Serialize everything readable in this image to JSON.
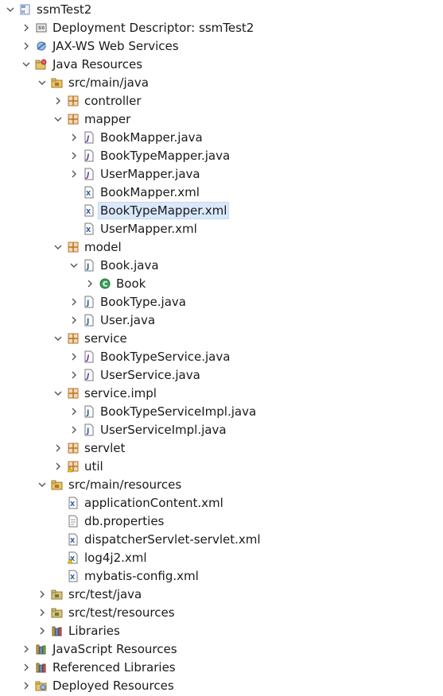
{
  "tree": [
    {
      "label": "ssmTest2",
      "icon": "web-project-icon",
      "level": 0,
      "expander": "expanded"
    },
    {
      "label": "Deployment Descriptor: ssmTest2",
      "icon": "deployment-descriptor-icon",
      "level": 1,
      "expander": "collapsed"
    },
    {
      "label": "JAX-WS Web Services",
      "icon": "web-services-icon",
      "level": 1,
      "expander": "collapsed"
    },
    {
      "label": "Java Resources",
      "icon": "java-resources-icon",
      "level": 1,
      "expander": "expanded"
    },
    {
      "label": "src/main/java",
      "icon": "source-folder-icon",
      "level": 2,
      "expander": "expanded"
    },
    {
      "label": "controller",
      "icon": "package-icon",
      "level": 3,
      "expander": "collapsed"
    },
    {
      "label": "mapper",
      "icon": "package-icon",
      "level": 3,
      "expander": "expanded"
    },
    {
      "label": "BookMapper.java",
      "icon": "java-interface-file-icon",
      "level": 4,
      "expander": "collapsed"
    },
    {
      "label": "BookTypeMapper.java",
      "icon": "java-interface-file-icon",
      "level": 4,
      "expander": "collapsed"
    },
    {
      "label": "UserMapper.java",
      "icon": "java-interface-file-icon",
      "level": 4,
      "expander": "collapsed"
    },
    {
      "label": "BookMapper.xml",
      "icon": "xml-file-icon",
      "level": 4,
      "expander": "none"
    },
    {
      "label": "BookTypeMapper.xml",
      "icon": "xml-file-icon",
      "level": 4,
      "expander": "none",
      "selected": true
    },
    {
      "label": "UserMapper.xml",
      "icon": "xml-file-icon",
      "level": 4,
      "expander": "none"
    },
    {
      "label": "model",
      "icon": "package-icon",
      "level": 3,
      "expander": "expanded"
    },
    {
      "label": "Book.java",
      "icon": "java-file-icon",
      "level": 4,
      "expander": "expanded"
    },
    {
      "label": "Book",
      "icon": "class-icon",
      "level": 5,
      "expander": "collapsed"
    },
    {
      "label": "BookType.java",
      "icon": "java-file-icon",
      "level": 4,
      "expander": "collapsed"
    },
    {
      "label": "User.java",
      "icon": "java-file-icon",
      "level": 4,
      "expander": "collapsed"
    },
    {
      "label": "service",
      "icon": "package-icon",
      "level": 3,
      "expander": "expanded"
    },
    {
      "label": "BookTypeService.java",
      "icon": "java-interface-file-icon",
      "level": 4,
      "expander": "collapsed"
    },
    {
      "label": "UserService.java",
      "icon": "java-interface-file-icon",
      "level": 4,
      "expander": "collapsed"
    },
    {
      "label": "service.impl",
      "icon": "package-icon",
      "level": 3,
      "expander": "expanded"
    },
    {
      "label": "BookTypeServiceImpl.java",
      "icon": "java-file-icon",
      "level": 4,
      "expander": "collapsed"
    },
    {
      "label": "UserServiceImpl.java",
      "icon": "java-file-icon",
      "level": 4,
      "expander": "collapsed"
    },
    {
      "label": "servlet",
      "icon": "package-icon",
      "level": 3,
      "expander": "collapsed"
    },
    {
      "label": "util",
      "icon": "package-warning-icon",
      "level": 3,
      "expander": "collapsed"
    },
    {
      "label": "src/main/resources",
      "icon": "source-folder-icon",
      "level": 2,
      "expander": "expanded"
    },
    {
      "label": "applicationContent.xml",
      "icon": "xml-file-icon",
      "level": 3,
      "expander": "none"
    },
    {
      "label": "db.properties",
      "icon": "text-file-icon",
      "level": 3,
      "expander": "none"
    },
    {
      "label": "dispatcherServlet-servlet.xml",
      "icon": "xml-file-icon",
      "level": 3,
      "expander": "none"
    },
    {
      "label": "log4j2.xml",
      "icon": "xml-warning-icon",
      "level": 3,
      "expander": "none"
    },
    {
      "label": "mybatis-config.xml",
      "icon": "xml-file-icon",
      "level": 3,
      "expander": "none"
    },
    {
      "label": "src/test/java",
      "icon": "test-folder-icon",
      "level": 2,
      "expander": "collapsed"
    },
    {
      "label": "src/test/resources",
      "icon": "test-folder-icon",
      "level": 2,
      "expander": "collapsed"
    },
    {
      "label": "Libraries",
      "icon": "libraries-icon",
      "level": 2,
      "expander": "collapsed"
    },
    {
      "label": "JavaScript Resources",
      "icon": "javascript-resources-icon",
      "level": 1,
      "expander": "collapsed"
    },
    {
      "label": "Referenced Libraries",
      "icon": "libraries-icon",
      "level": 1,
      "expander": "collapsed"
    },
    {
      "label": "Deployed Resources",
      "icon": "deployed-resources-icon",
      "level": 1,
      "expander": "collapsed"
    }
  ],
  "colors": {
    "selection": "#d9e8fb",
    "package": "#b5722b",
    "java_file": "#2b5aa0",
    "class": "#2f9e44",
    "folder": "#c9a24a"
  }
}
